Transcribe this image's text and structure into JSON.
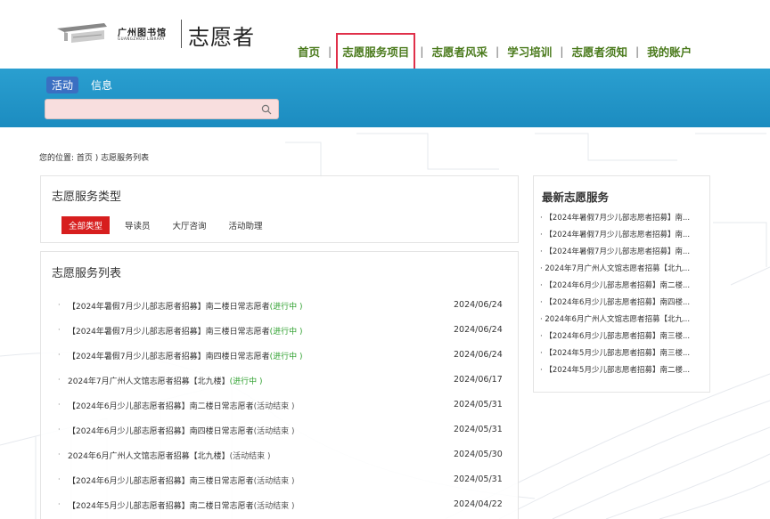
{
  "header": {
    "logo_cn": "广州图书馆",
    "logo_en": "GUANGZHOU LIBRARY",
    "site_title": "志愿者",
    "nav": [
      {
        "label": "首页"
      },
      {
        "label": "志愿服务项目"
      },
      {
        "label": "志愿者风采"
      },
      {
        "label": "学习培训"
      },
      {
        "label": "志愿者须知"
      },
      {
        "label": "我的账户"
      }
    ],
    "nav_separator": "|"
  },
  "search_band": {
    "tabs": [
      {
        "label": "活动"
      },
      {
        "label": "信息"
      }
    ],
    "search_placeholder": "",
    "search_value": ""
  },
  "breadcrumb": "您的位置: 首页 ) 志愿服务列表",
  "type_panel": {
    "title": "志愿服务类型",
    "filters": [
      {
        "label": "全部类型"
      },
      {
        "label": "导读员"
      },
      {
        "label": "大厅咨询"
      },
      {
        "label": "活动助理"
      }
    ]
  },
  "list_panel": {
    "title": "志愿服务列表",
    "rows": [
      {
        "title": "【2024年暑假7月少儿部志愿者招募】南二楼日常志愿者",
        "status": "(进行中 )",
        "date": "2024/06/24"
      },
      {
        "title": "【2024年暑假7月少儿部志愿者招募】南三楼日常志愿者",
        "status": "(进行中 )",
        "date": "2024/06/24"
      },
      {
        "title": "【2024年暑假7月少儿部志愿者招募】南四楼日常志愿者",
        "status": "(进行中 )",
        "date": "2024/06/24"
      },
      {
        "title": "2024年7月广州人文馆志愿者招募【北九楼】",
        "status": "(进行中 )",
        "date": "2024/06/17"
      },
      {
        "title": "【2024年6月少儿部志愿者招募】南二楼日常志愿者",
        "status": "(活动结束 )",
        "date": "2024/05/31"
      },
      {
        "title": "【2024年6月少儿部志愿者招募】南四楼日常志愿者",
        "status": "(活动结束 )",
        "date": "2024/05/31"
      },
      {
        "title": "2024年6月广州人文馆志愿者招募【北九楼】",
        "status": "(活动结束 )",
        "date": "2024/05/30"
      },
      {
        "title": "【2024年6月少儿部志愿者招募】南三楼日常志愿者",
        "status": "(活动结束 )",
        "date": "2024/05/31"
      },
      {
        "title": "【2024年5月少儿部志愿者招募】南二楼日常志愿者",
        "status": "(活动结束 )",
        "date": "2024/04/22"
      }
    ]
  },
  "latest_panel": {
    "title": "最新志愿服务",
    "items": [
      "· 【2024年暑假7月少儿部志愿者招募】南...",
      "· 【2024年暑假7月少儿部志愿者招募】南...",
      "· 【2024年暑假7月少儿部志愿者招募】南...",
      "· 2024年7月广州人文馆志愿者招募【北九...",
      "· 【2024年6月少儿部志愿者招募】南二楼...",
      "· 【2024年6月少儿部志愿者招募】南四楼...",
      "· 2024年6月广州人文馆志愿者招募【北九...",
      "· 【2024年6月少儿部志愿者招募】南三楼...",
      "· 【2024年5月少儿部志愿者招募】南三楼...",
      "· 【2024年5月少儿部志愿者招募】南二楼..."
    ]
  },
  "colors": {
    "nav_text": "#4a7a1c",
    "band_blue": "#1c8cc0",
    "active_filter": "#d71e1e",
    "status_active": "#2ea02e",
    "nav_highlight": "#e0304a"
  },
  "icons": {
    "search": "search-icon",
    "logo": "library-building-logo-icon"
  }
}
